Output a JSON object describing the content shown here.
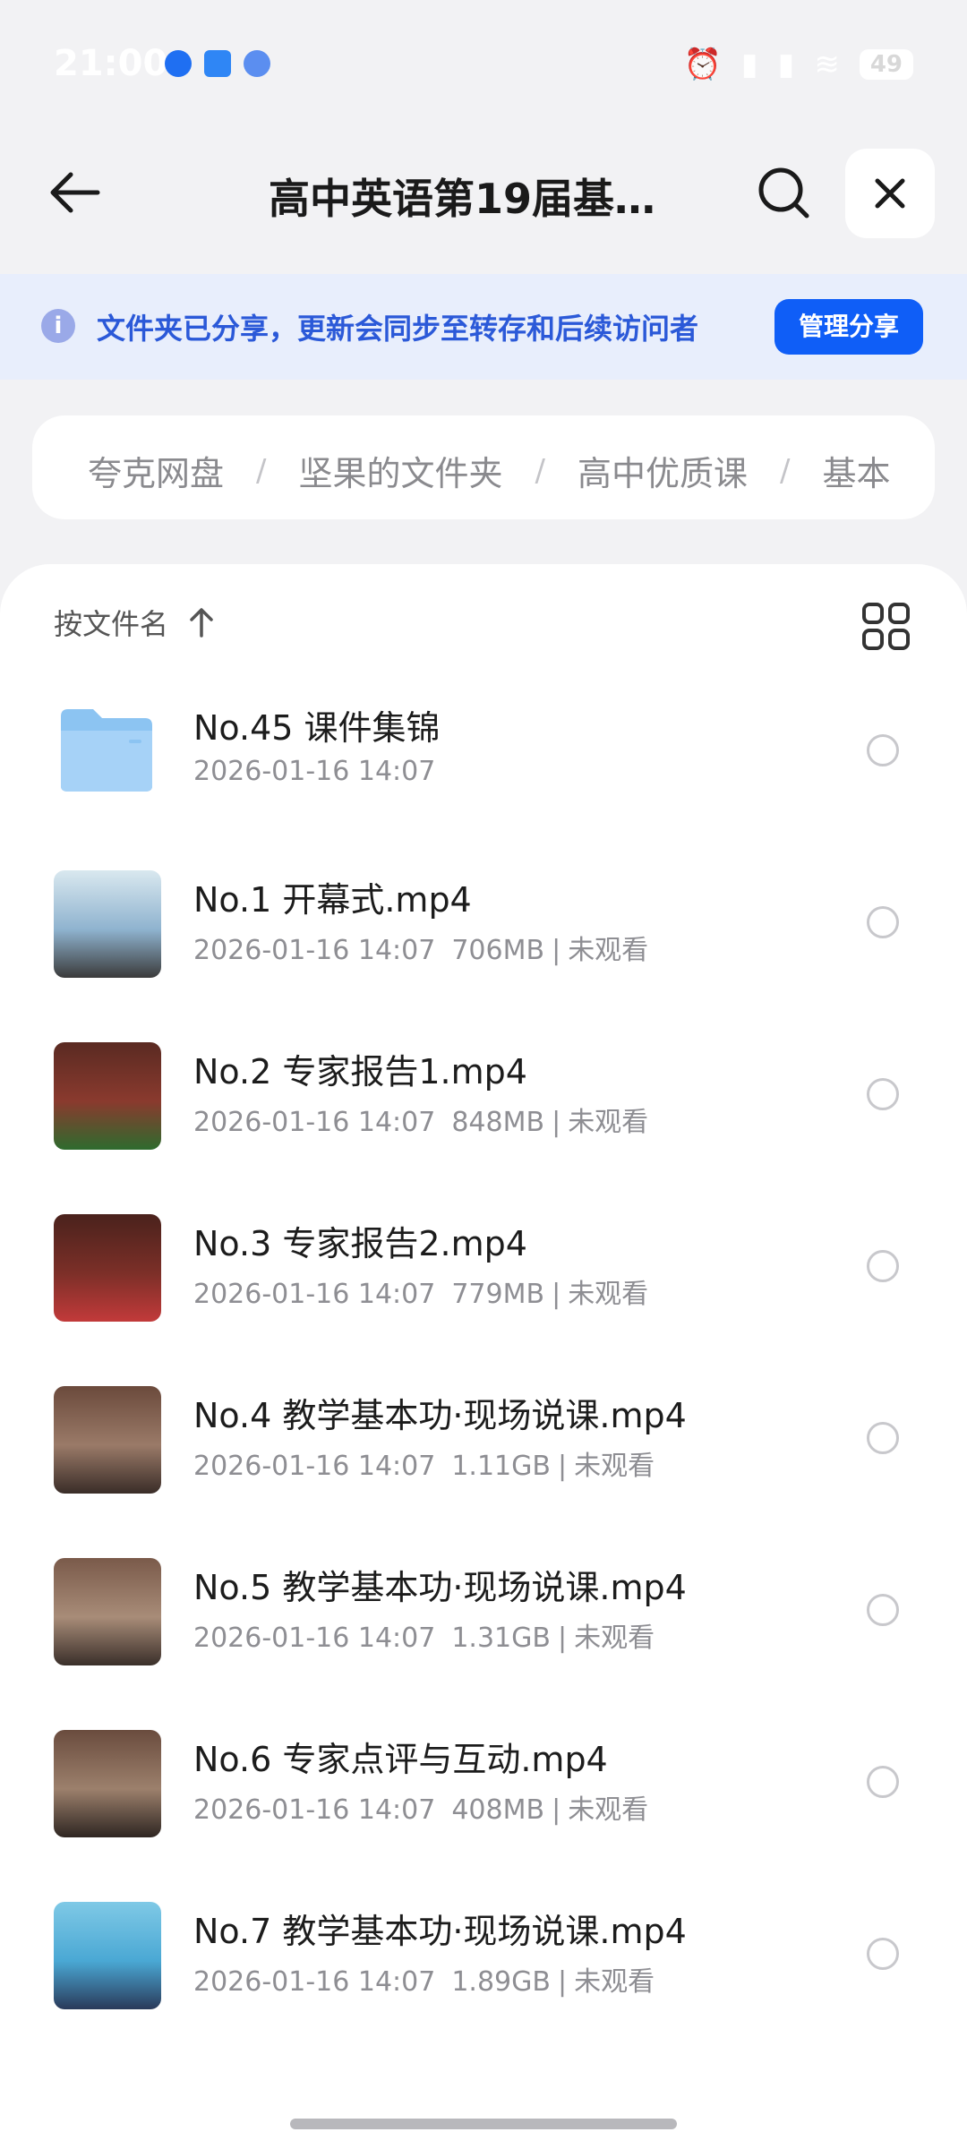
{
  "status_bar": {
    "time": "21:00",
    "battery": "49"
  },
  "header": {
    "title": "高中英语第19届基…"
  },
  "banner": {
    "text": "文件夹已分享，更新会同步至转存和后续访问者",
    "button": "管理分享"
  },
  "breadcrumb": [
    "夸克网盘",
    "坚果的文件夹",
    "高中优质课",
    "基本"
  ],
  "sort": {
    "label": "按文件名"
  },
  "files": [
    {
      "name": "No.45 课件集锦",
      "date": "2026-01-16 14:07",
      "size": "",
      "status": "",
      "type": "folder"
    },
    {
      "name": "No.1 开幕式.mp4",
      "date": "2026-01-16 14:07",
      "size": "706MB",
      "status": "未观看",
      "type": "video",
      "thumb": [
        "#d9e8ef",
        "#8fb3cf",
        "#3b3b3b"
      ]
    },
    {
      "name": "No.2 专家报告1.mp4",
      "date": "2026-01-16 14:07",
      "size": "848MB",
      "status": "未观看",
      "type": "video",
      "thumb": [
        "#5a2a22",
        "#8a3a2e",
        "#2e6b2e"
      ]
    },
    {
      "name": "No.3 专家报告2.mp4",
      "date": "2026-01-16 14:07",
      "size": "779MB",
      "status": "未观看",
      "type": "video",
      "thumb": [
        "#4a221c",
        "#7c2f28",
        "#c23a3a"
      ]
    },
    {
      "name": "No.4 教学基本功·现场说课.mp4",
      "date": "2026-01-16 14:07",
      "size": "1.11GB",
      "status": "未观看",
      "type": "video",
      "thumb": [
        "#6b4a3c",
        "#9a7a68",
        "#3a2d28"
      ]
    },
    {
      "name": "No.5 教学基本功·现场说课.mp4",
      "date": "2026-01-16 14:07",
      "size": "1.31GB",
      "status": "未观看",
      "type": "video",
      "thumb": [
        "#7a5a4a",
        "#a88c78",
        "#3a2f2a"
      ]
    },
    {
      "name": "No.6 专家点评与互动.mp4",
      "date": "2026-01-16 14:07",
      "size": "408MB",
      "status": "未观看",
      "type": "video",
      "thumb": [
        "#6a4c3e",
        "#9c806c",
        "#2f2622"
      ]
    },
    {
      "name": "No.7 教学基本功·现场说课.mp4",
      "date": "2026-01-16 14:07",
      "size": "1.89GB",
      "status": "未观看",
      "type": "video",
      "thumb": [
        "#7fc9e6",
        "#4aa8d4",
        "#2a3a5a"
      ]
    }
  ],
  "colors": {
    "accent": "#0f5ef7",
    "banner_bg": "#e8eefc",
    "folder": "#8cc4f2"
  }
}
